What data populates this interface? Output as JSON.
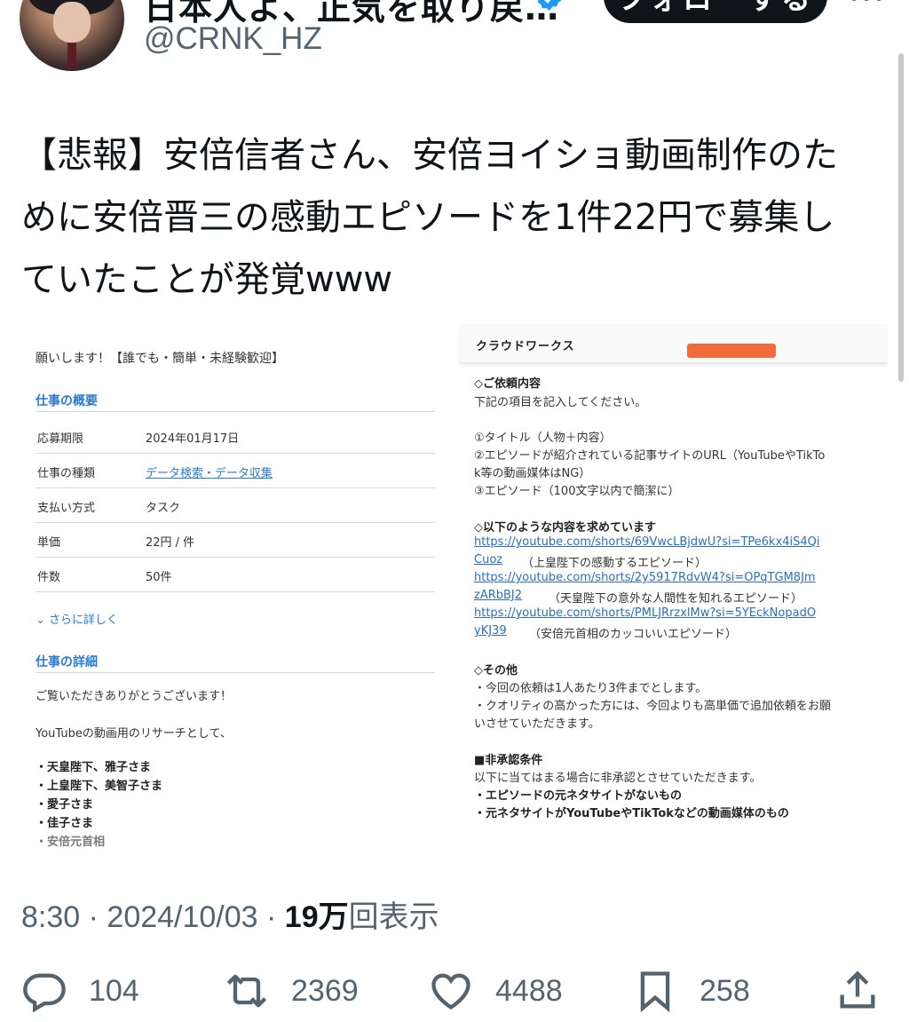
{
  "author": {
    "display_name": "日本人よ、正気を取り戻…",
    "handle": "@CRNK_HZ",
    "follow_label": "フォローする"
  },
  "tweet": {
    "lines": [
      "【悲報】安倍信者さん、安倍ヨイショ動画制作のた",
      "めに安倍晋三の感動エピソードを1件22円で募集し",
      "ていたことが発覚www"
    ]
  },
  "media": {
    "left": {
      "title": "願いします！【誰でも・簡単・未経験歓迎】",
      "overview_heading": "仕事の概要",
      "rows": [
        {
          "label": "応募期限",
          "value": "2024年01月17日"
        },
        {
          "label": "仕事の種類",
          "value": "データ検索・データ収集"
        },
        {
          "label": "支払い方式",
          "value": "タスク"
        },
        {
          "label": "単価",
          "value": "22円 / 件"
        },
        {
          "label": "件数",
          "value": "50件"
        }
      ],
      "more_label": "⌄ さらに詳しく",
      "detail_heading": "仕事の詳細",
      "detail_lines": [
        "ご覧いただきありがとうございます！",
        "YouTubeの動画用のリサーチとして、"
      ],
      "bullets": [
        "・天皇陛下、雅子さま",
        "・上皇陛下、美智子さま",
        "・愛子さま",
        "・佳子さま",
        "・安倍元首相"
      ]
    },
    "right": {
      "brand": "クラウドワークス",
      "lines": [
        {
          "text": "◇ご依頼内容",
          "bold": true
        },
        {
          "text": "下記の項目を記入してください。",
          "bold": false
        },
        {
          "text": "①タイトル（人物＋内容）",
          "bold": false
        },
        {
          "text": "②エピソードが紹介されている記事サイトのURL（YouTubeやTikTo",
          "bold": false
        },
        {
          "text": "k等の動画媒体はNG）",
          "bold": false
        },
        {
          "text": "③エピソード（100文字以内で簡潔に）",
          "bold": false
        },
        {
          "text": "◇以下のような内容を求めています",
          "bold": true
        }
      ],
      "links": [
        {
          "line1": "https://youtube.com/shorts/69VwcLBjdwU?si=TPe6kx4iS4Qi",
          "line2": "Cuoz",
          "note": "（上皇陛下の感動するエピソード）"
        },
        {
          "line1": "https://youtube.com/shorts/2y5917RdvW4?si=OPqTGM8Jm",
          "line2": "zARbBJ2",
          "note": "（天皇陛下の意外な人間性を知れるエピソード）"
        },
        {
          "line1": "https://youtube.com/shorts/PMLJRrzxlMw?si=5YEckNopadO",
          "line2": "yKJ39",
          "note": "（安倍元首相のカッコいいエピソード）"
        }
      ],
      "other_heading": "◇その他",
      "other_lines": [
        "・今回の依頼は1人あたり3件までとします。",
        "・クオリティの高かった方には、今回よりも高単価で追加依頼をお願",
        "いさせていただきます。"
      ],
      "reject_heading": "■非承認条件",
      "reject_lines": [
        "以下に当てはまる場合に非承認とさせていただきます。",
        "・エピソードの元ネタサイトがないもの",
        "・元ネタサイトがYouTubeやTikTokなどの動画媒体のもの"
      ]
    }
  },
  "meta": {
    "time": "8:30",
    "sep1": " · ",
    "date": "2024/10/03",
    "sep2": " · ",
    "views_num": "19万",
    "views_label": "回表示"
  },
  "actions": {
    "replies": "104",
    "retweets": "2369",
    "likes": "4488",
    "bookmarks": "258"
  },
  "colors": {
    "verified": "#1d9bf0",
    "follow_bg": "#0f1419",
    "secondary_text": "#536471",
    "link_blue": "#2a7ad4",
    "accent_orange": "#f26b3a"
  }
}
